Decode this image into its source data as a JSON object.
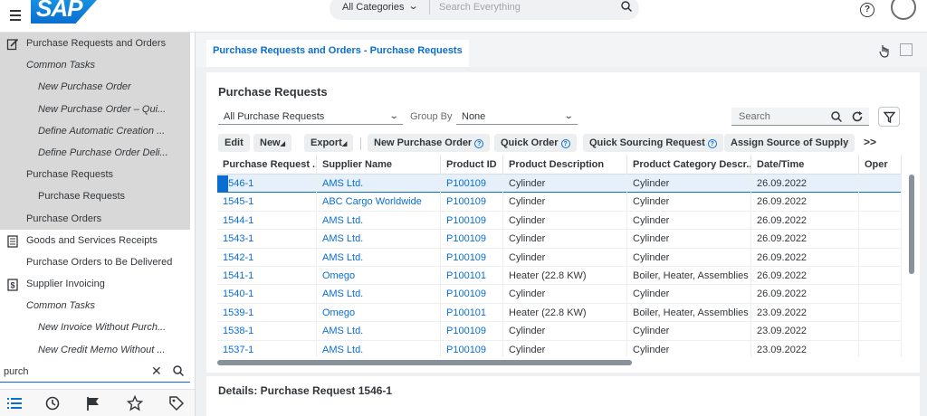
{
  "shell": {
    "logo": "SAP",
    "search_category": "All Categories",
    "search_placeholder": "Search Everything",
    "help_icon": "help-icon",
    "avatar": "user-avatar"
  },
  "nav": {
    "items": [
      {
        "label": "Purchase Requests and Orders",
        "level": "lvl0",
        "icon": "edit-icon",
        "highlight": true
      },
      {
        "label": "Common Tasks",
        "level": "lvl1",
        "highlight": true
      },
      {
        "label": "New Purchase Order",
        "level": "lvl2",
        "highlight": true
      },
      {
        "label": "New Purchase Order – Qui...",
        "level": "lvl2",
        "highlight": true
      },
      {
        "label": "Define Automatic Creation ...",
        "level": "lvl2",
        "highlight": true
      },
      {
        "label": "Define Purchase Order Deli...",
        "level": "lvl2",
        "highlight": true
      },
      {
        "label": "Purchase Requests",
        "level": "lvl1n",
        "highlight": true
      },
      {
        "label": "Purchase Requests",
        "level": "lvl2n",
        "highlight": true
      },
      {
        "label": "Purchase Orders",
        "level": "lvl1n",
        "highlight": true
      },
      {
        "label": "Goods and Services Receipts",
        "level": "lvl0",
        "icon": "receipt-icon",
        "highlight": false
      },
      {
        "label": "Purchase Orders to Be Delivered",
        "level": "lvl1n",
        "highlight": false
      },
      {
        "label": "Supplier Invoicing",
        "level": "lvl0",
        "icon": "invoice-icon",
        "highlight": false
      },
      {
        "label": "Common Tasks",
        "level": "lvl1",
        "highlight": false
      },
      {
        "label": "New Invoice Without Purch...",
        "level": "lvl2",
        "highlight": false
      },
      {
        "label": "New Credit Memo Without ...",
        "level": "lvl2",
        "highlight": false
      }
    ],
    "filter_value": "purch",
    "tabs": [
      "list-icon",
      "history-icon",
      "flag-icon",
      "favorites-icon",
      "tag-icon"
    ]
  },
  "main": {
    "tab_label": "Purchase Requests and Orders - Purchase Requests",
    "card_title": "Purchase Requests",
    "view_select": "All Purchase Requests",
    "group_by_label": "Group By",
    "group_by_value": "None",
    "search_placeholder": "Search",
    "toolbar": {
      "edit": "Edit",
      "new": "New",
      "export": "Export",
      "new_po": "New Purchase Order",
      "quick_order": "Quick Order",
      "quick_sourcing": "Quick Sourcing Request",
      "assign_source": "Assign Source of Supply",
      "more": ">>"
    },
    "columns": [
      "Purchase Request ...",
      "Supplier Name",
      "Product ID",
      "Product Description",
      "Product Category Descr...",
      "Date/Time",
      "Oper"
    ],
    "rows": [
      [
        "1546-1",
        "AMS Ltd.",
        "P100109",
        "Cylinder",
        "Cylinder",
        "26.09.2022"
      ],
      [
        "1545-1",
        "ABC Cargo Worldwide",
        "P100109",
        "Cylinder",
        "Cylinder",
        "26.09.2022"
      ],
      [
        "1544-1",
        "AMS Ltd.",
        "P100109",
        "Cylinder",
        "Cylinder",
        "26.09.2022"
      ],
      [
        "1543-1",
        "AMS Ltd.",
        "P100109",
        "Cylinder",
        "Cylinder",
        "26.09.2022"
      ],
      [
        "1542-1",
        "AMS Ltd.",
        "P100109",
        "Cylinder",
        "Cylinder",
        "26.09.2022"
      ],
      [
        "1541-1",
        "Omego",
        "P100101",
        "Heater (22.8 KW)",
        "Boiler, Heater, Assemblies",
        "26.09.2022"
      ],
      [
        "1540-1",
        "AMS Ltd.",
        "P100109",
        "Cylinder",
        "Cylinder",
        "26.09.2022"
      ],
      [
        "1539-1",
        "Omego",
        "P100101",
        "Heater (22.8 KW)",
        "Boiler, Heater, Assemblies",
        "23.09.2022"
      ],
      [
        "1538-1",
        "AMS Ltd.",
        "P100109",
        "Cylinder",
        "Cylinder",
        "23.09.2022"
      ],
      [
        "1537-1",
        "AMS Ltd.",
        "P100109",
        "Cylinder",
        "Cylinder",
        "23.09.2022"
      ]
    ],
    "selected_row": 0,
    "details_title": "Details: Purchase Request 1546-1"
  }
}
